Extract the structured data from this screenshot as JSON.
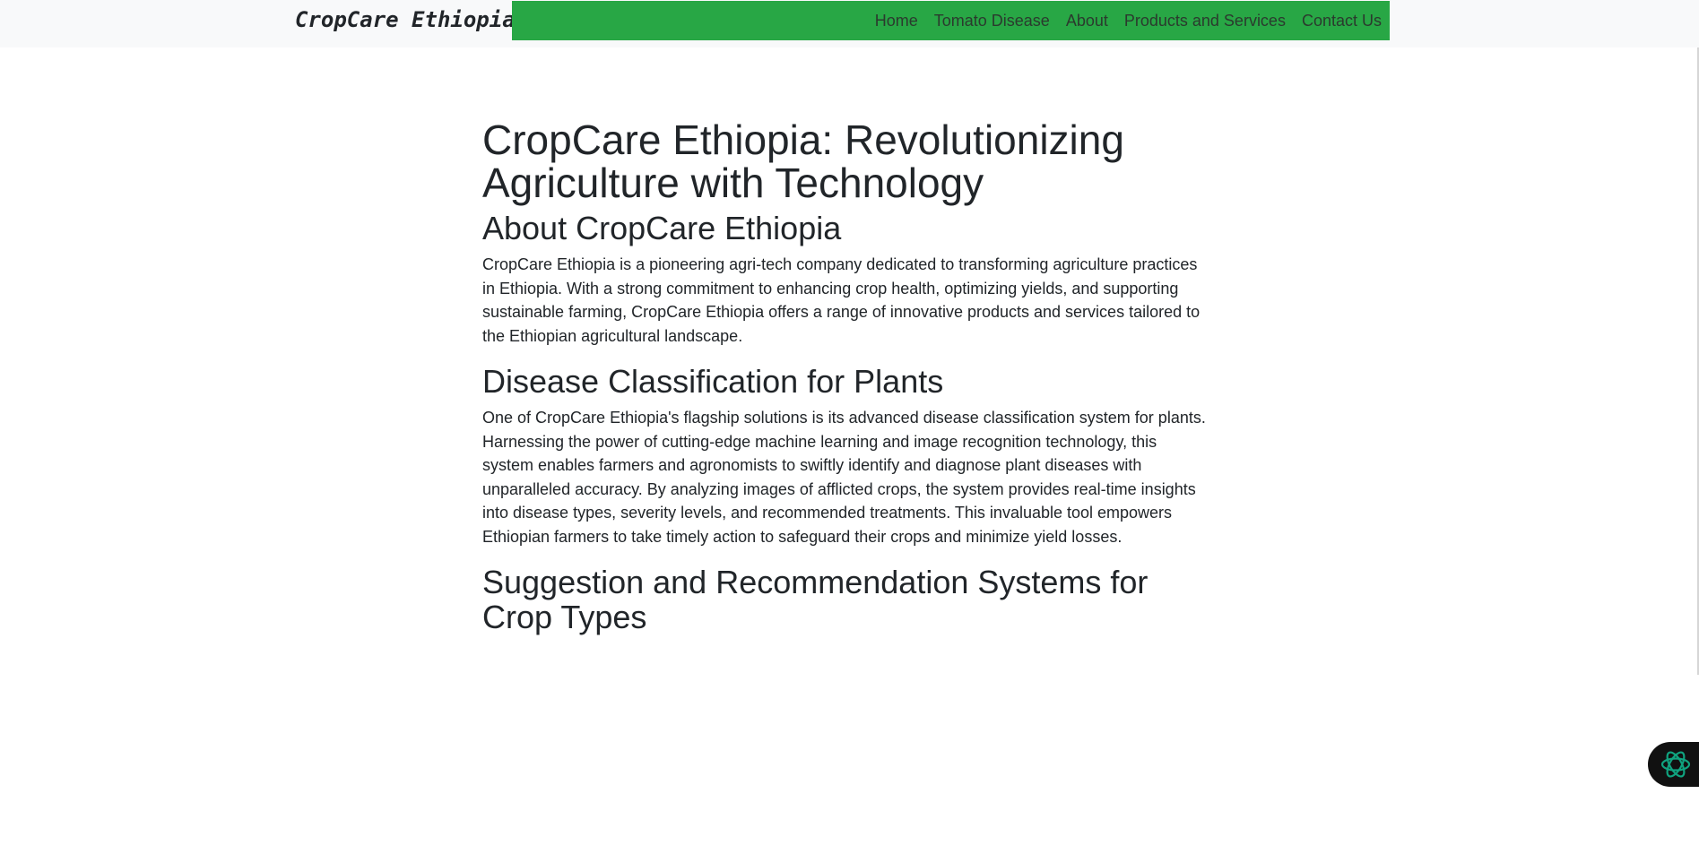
{
  "navbar": {
    "brand": "CropCare Ethiopia",
    "links": [
      "Home",
      "Tomato Disease",
      "About",
      "Products and Services",
      "Contact Us"
    ],
    "accent_color": "#28a745"
  },
  "main": {
    "title": "CropCare Ethiopia: Revolutionizing Agriculture with Technology",
    "sections": [
      {
        "heading": "About CropCare Ethiopia",
        "body": "CropCare Ethiopia is a pioneering agri-tech company dedicated to transforming agriculture practices in Ethiopia. With a strong commitment to enhancing crop health, optimizing yields, and supporting sustainable farming, CropCare Ethiopia offers a range of innovative products and services tailored to the Ethiopian agricultural landscape."
      },
      {
        "heading": "Disease Classification for Plants",
        "body": "One of CropCare Ethiopia's flagship solutions is its advanced disease classification system for plants. Harnessing the power of cutting-edge machine learning and image recognition technology, this system enables farmers and agronomists to swiftly identify and diagnose plant diseases with unparalleled accuracy. By analyzing images of afflicted crops, the system provides real-time insights into disease types, severity levels, and recommended treatments. This invaluable tool empowers Ethiopian farmers to take timely action to safeguard their crops and minimize yield losses."
      },
      {
        "heading": "Suggestion and Recommendation Systems for Crop Types"
      }
    ]
  },
  "floating": {
    "icon": "ai-assistant-icon",
    "icon_color": "#10a37f"
  }
}
